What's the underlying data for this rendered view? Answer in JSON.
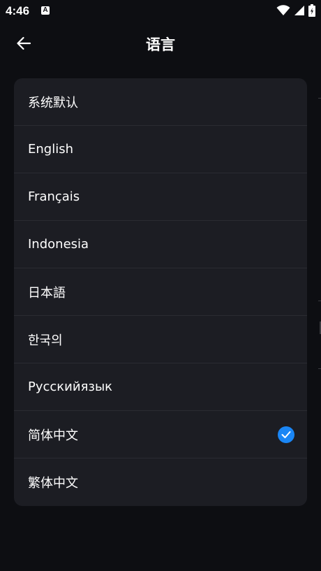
{
  "status_bar": {
    "time": "4:46",
    "notification_letter": "A"
  },
  "header": {
    "title": "语言"
  },
  "languages": {
    "items": [
      {
        "label": "系统默认",
        "selected": false
      },
      {
        "label": "English",
        "selected": false
      },
      {
        "label": "Français",
        "selected": false
      },
      {
        "label": "Indonesia",
        "selected": false
      },
      {
        "label": "日本語",
        "selected": false
      },
      {
        "label": "한국의",
        "selected": false
      },
      {
        "label": "Русскийязык",
        "selected": false
      },
      {
        "label": "简体中文",
        "selected": true
      },
      {
        "label": "繁体中文",
        "selected": false
      }
    ]
  },
  "colors": {
    "background": "#0d0e12",
    "card": "#1c1d23",
    "divider": "#2a2b32",
    "accent": "#1a86f5",
    "text": "#ffffff"
  },
  "icons": {
    "back": "arrow-left-icon",
    "selected": "check-circle-icon",
    "wifi": "wifi-icon",
    "signal": "signal-icon",
    "battery": "battery-icon"
  }
}
